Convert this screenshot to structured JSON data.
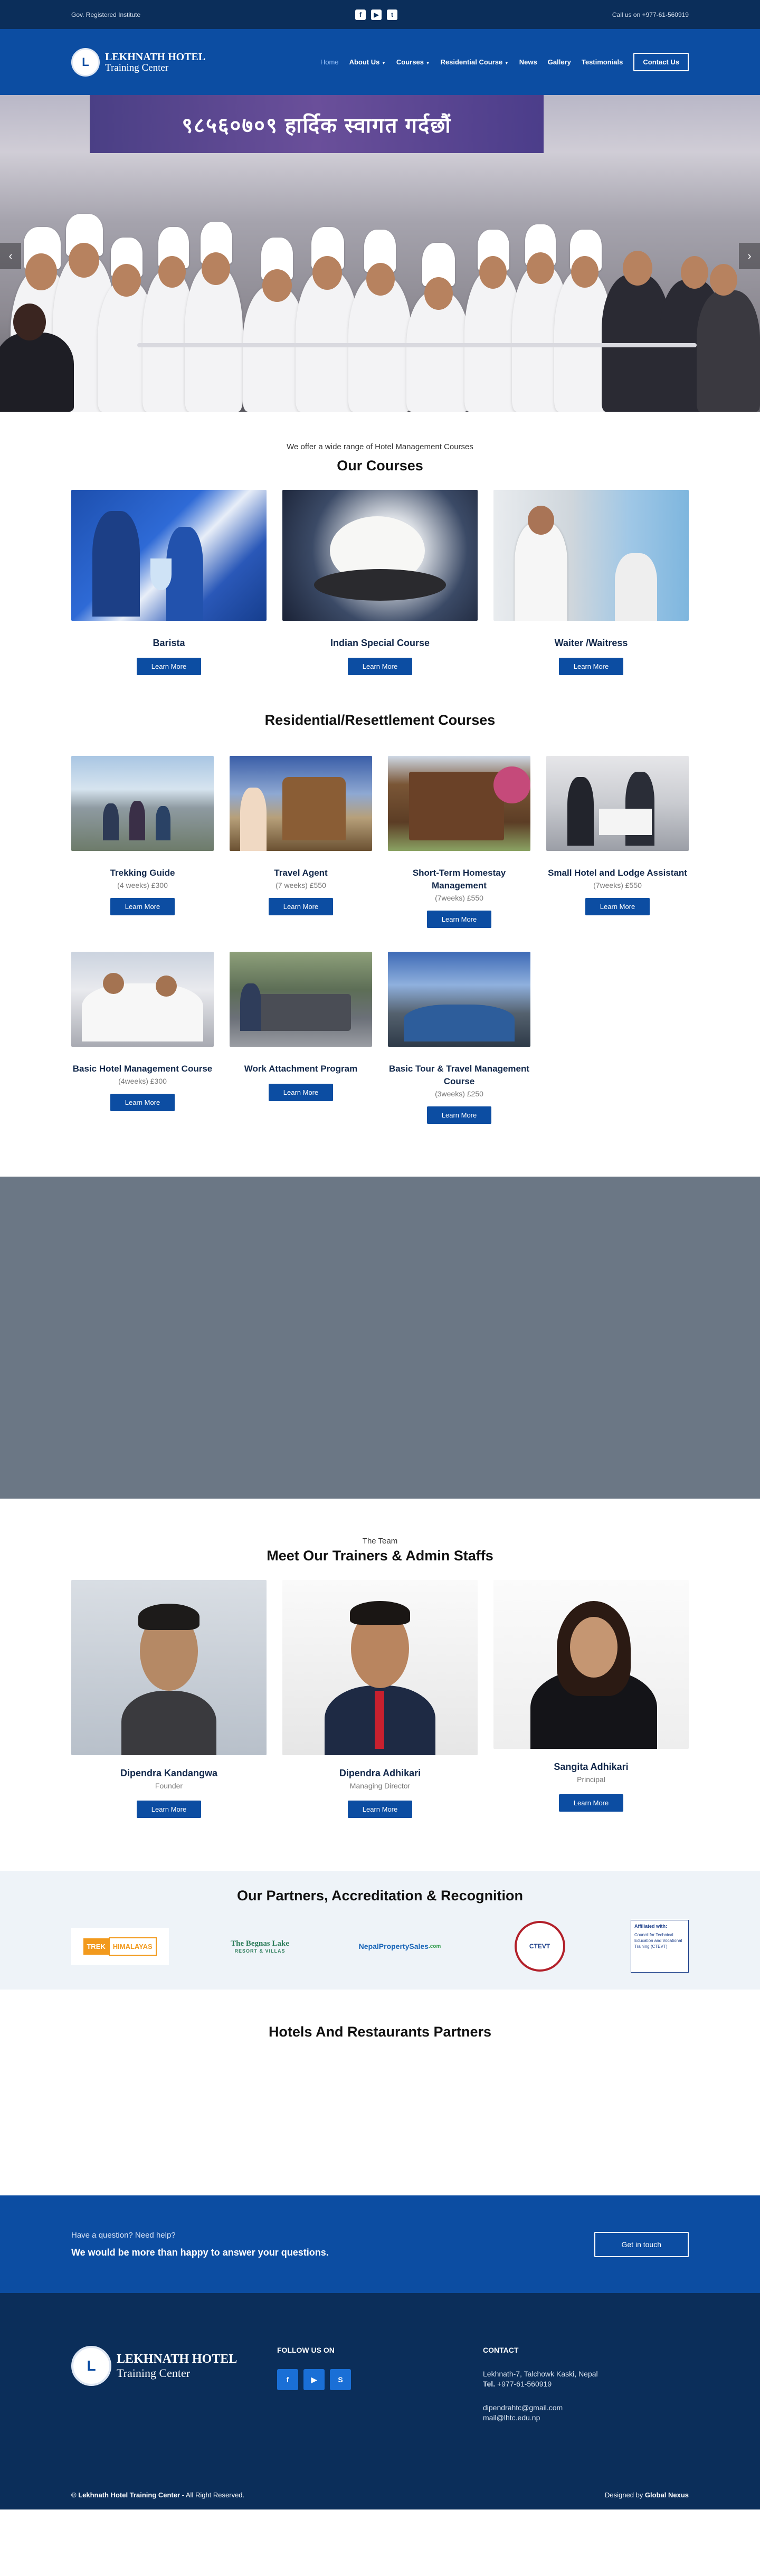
{
  "topbar": {
    "left_text": "Gov. Registered Institute",
    "social_icons": [
      "facebook-icon",
      "youtube-icon",
      "twitter-icon"
    ],
    "call_text": "Call us on +977-61-560919"
  },
  "header": {
    "logo_mark": "L",
    "logo_line1": "LEKHNATH HOTEL",
    "logo_line2": "Training Center",
    "nav": [
      {
        "label": "Home",
        "active": true
      },
      {
        "label": "About Us",
        "dropdown": true
      },
      {
        "label": "Courses",
        "dropdown": true
      },
      {
        "label": "Residential Course",
        "dropdown": true
      },
      {
        "label": "News"
      },
      {
        "label": "Gallery"
      },
      {
        "label": "Testimonials"
      }
    ],
    "contact_label": "Contact Us"
  },
  "hero": {
    "banner_text": "९८५६०७०९ हार्दिक स्वागत गर्दछौं",
    "prev_icon": "‹",
    "next_icon": "›"
  },
  "courses": {
    "subtitle": "We offer a wide range of Hotel Management Courses",
    "title": "Our Courses",
    "items": [
      {
        "title": "Barista",
        "button": "Learn More"
      },
      {
        "title": "Indian Special Course",
        "button": "Learn More"
      },
      {
        "title": "Waiter /Waitress",
        "button": "Learn More"
      }
    ]
  },
  "residential": {
    "title": "Residential/Resettlement Courses",
    "items": [
      {
        "title": "Trekking Guide",
        "meta": "(4 weeks) £300",
        "button": "Learn More"
      },
      {
        "title": "Travel Agent",
        "meta": "(7 weeks) £550",
        "button": "Learn More"
      },
      {
        "title": "Short-Term Homestay Management",
        "meta": "(7weeks) £550",
        "button": "Learn More"
      },
      {
        "title": "Small Hotel and Lodge Assistant",
        "meta": "(7weeks) £550",
        "button": "Learn More"
      },
      {
        "title": "Basic Hotel Management Course",
        "meta": "(4weeks) £300",
        "button": "Learn More"
      },
      {
        "title": "Work Attachment Program",
        "meta": "",
        "button": "Learn More"
      },
      {
        "title": "Basic Tour & Travel Management Course",
        "meta": "(3weeks) £250",
        "button": "Learn More"
      }
    ]
  },
  "team": {
    "subtitle": "The Team",
    "title": "Meet Our Trainers & Admin Staffs",
    "members": [
      {
        "name": "Dipendra Kandangwa",
        "role": "Founder",
        "button": "Learn More"
      },
      {
        "name": "Dipendra Adhikari",
        "role": "Managing Director",
        "button": "Learn More"
      },
      {
        "name": "Sangita Adhikari",
        "role": "Principal",
        "button": "Learn More"
      }
    ]
  },
  "partners": {
    "title": "Our Partners, Accreditation & Recognition",
    "logos": [
      {
        "text": "TREK",
        "text2": "HIMALAYAS"
      },
      {
        "text": "The Begnas Lake",
        "text2": "RESORT & VILLAS"
      },
      {
        "text": "NepalPropertySales",
        "text2": ".com"
      },
      {
        "text": "CTEVT"
      },
      {
        "text": "Affiliated with:",
        "text2": "Council for Technical Education and Vocational Training (CTEVT)"
      }
    ]
  },
  "hotels": {
    "title": "Hotels And Restaurants Partners"
  },
  "cta": {
    "question": "Have a question? Need help?",
    "main": "We would be more than happy to answer your questions.",
    "button": "Get in touch"
  },
  "footer": {
    "logo_line1": "LEKHNATH HOTEL",
    "logo_line2": "Training Center",
    "follow_title": "FOLLOW US ON",
    "contact_title": "CONTACT",
    "address": "Lekhnath-7, Talchowk Kaski, Nepal",
    "tel_label": "Tel.",
    "tel": "+977-61-560919",
    "email1": "dipendrahtc@gmail.com",
    "email2": "mail@lhtc.edu.np",
    "copyright_bold": "© Lekhnath Hotel Training Center",
    "copyright_rest": " - All Right Reserved.",
    "designed_by": "Designed by ",
    "designer": "Global Nexus"
  },
  "colors": {
    "primary": "#0c4da2",
    "dark": "#0b2e5a",
    "band": "#6b7785"
  }
}
